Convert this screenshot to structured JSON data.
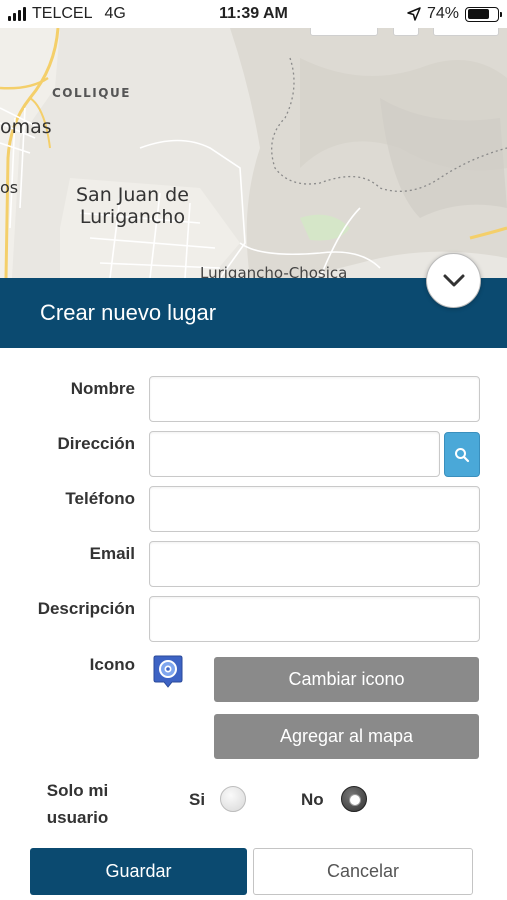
{
  "status_bar": {
    "carrier": "TELCEL",
    "network": "4G",
    "time": "11:39 AM",
    "battery": "74%",
    "battery_level": 0.74
  },
  "map": {
    "labels": {
      "colli": "COLLIQUE",
      "omas": "omas",
      "os": "os",
      "sjl_line1": "San Juan de",
      "sjl_line2": "Lurigancho",
      "chosica": "Lurigancho-Chosica"
    }
  },
  "header": {
    "title": "Crear nuevo lugar"
  },
  "form": {
    "nombre_label": "Nombre",
    "nombre_value": "",
    "direccion_label": "Dirección",
    "direccion_value": "",
    "telefono_label": "Teléfono",
    "telefono_value": "",
    "email_label": "Email",
    "email_value": "",
    "descripcion_label": "Descripción",
    "descripcion_value": "",
    "icono_label": "Icono",
    "cambiar_icono": "Cambiar icono",
    "agregar_mapa": "Agregar al mapa",
    "solo_label_1": "Solo mi",
    "solo_label_2": "usuario",
    "si_label": "Si",
    "no_label": "No",
    "selected_option": "No"
  },
  "actions": {
    "save": "Guardar",
    "cancel": "Cancelar"
  },
  "colors": {
    "primary": "#0b4a70",
    "search_button": "#4aa8d8",
    "gray_button": "#8a8a8a"
  },
  "icons": [
    "location-arrow-icon",
    "chevron-down-icon",
    "search-icon",
    "place-marker-icon"
  ]
}
